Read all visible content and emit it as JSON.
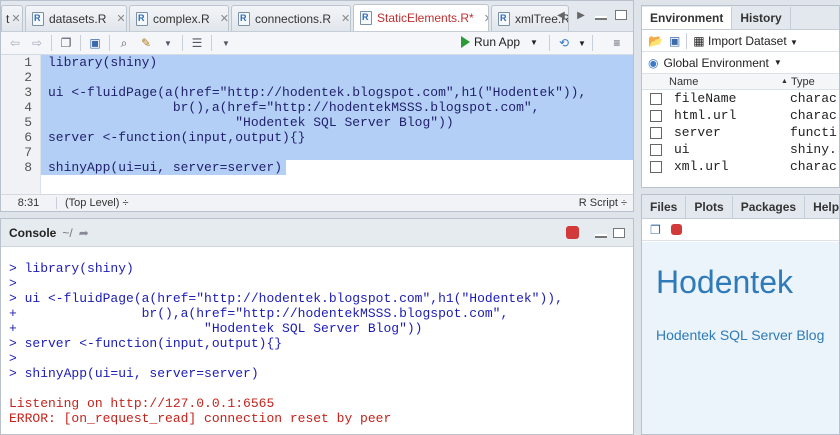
{
  "editor": {
    "tabs": [
      {
        "label": "t",
        "active": false
      },
      {
        "label": "datasets.R",
        "active": false
      },
      {
        "label": "complex.R",
        "active": false
      },
      {
        "label": "connections.R",
        "active": false
      },
      {
        "label": "StaticElements.R*",
        "active": true
      },
      {
        "label": "xmlTree.R",
        "active": false
      }
    ],
    "run_app_label": "Run App",
    "line_numbers": [
      "1",
      "2",
      "3",
      "4",
      "5",
      "6",
      "7",
      "8"
    ],
    "code_lines": [
      "library(shiny)",
      "",
      "ui <-fluidPage(a(href=\"http://hodentek.blogspot.com\",h1(\"Hodentek\")),",
      "                br(),a(href=\"http://hodentekMSSS.blogspot.com\",",
      "                        \"Hodentek SQL Server Blog\"))",
      "server <-function(input,output){}",
      "",
      "shinyApp(ui=ui, server=server)"
    ],
    "status": {
      "position": "8:31",
      "scope": "(Top Level) ÷",
      "file_type": "R Script ÷"
    }
  },
  "console": {
    "title": "Console",
    "dir": "~/",
    "lines": [
      {
        "text": "> library(shiny)",
        "kind": "cmd"
      },
      {
        "text": ">",
        "kind": "cmd"
      },
      {
        "text": "> ui <-fluidPage(a(href=\"http://hodentek.blogspot.com\",h1(\"Hodentek\")),",
        "kind": "cmd"
      },
      {
        "text": "+                br(),a(href=\"http://hodentekMSSS.blogspot.com\",",
        "kind": "cmd"
      },
      {
        "text": "+                        \"Hodentek SQL Server Blog\"))",
        "kind": "cmd"
      },
      {
        "text": "> server <-function(input,output){}",
        "kind": "cmd"
      },
      {
        "text": ">",
        "kind": "cmd"
      },
      {
        "text": "> shinyApp(ui=ui, server=server)",
        "kind": "cmd"
      },
      {
        "text": "",
        "kind": "blank"
      },
      {
        "text": "Listening on http://127.0.0.1:6565",
        "kind": "err"
      },
      {
        "text": "ERROR: [on_request_read] connection reset by peer",
        "kind": "err"
      }
    ]
  },
  "environment": {
    "tabs": [
      "Environment",
      "History"
    ],
    "import_label": "Import Dataset",
    "scope_label": "Global Environment",
    "columns": {
      "name": "Name",
      "type": "Type"
    },
    "rows": [
      {
        "name": "fileName",
        "type": "charac"
      },
      {
        "name": "html.url",
        "type": "charac"
      },
      {
        "name": "server",
        "type": "functi"
      },
      {
        "name": "ui",
        "type": "shiny."
      },
      {
        "name": "xml.url",
        "type": "charac"
      }
    ]
  },
  "viewer": {
    "tabs": [
      "Files",
      "Plots",
      "Packages",
      "Help"
    ],
    "heading": "Hodentek",
    "link_text": "Hodentek SQL Server Blog"
  },
  "colors": {
    "selection": "#b4cff5",
    "console_cmd": "#1c1cb5",
    "console_err": "#c4231c",
    "viewer_link": "#2f7ab8"
  }
}
